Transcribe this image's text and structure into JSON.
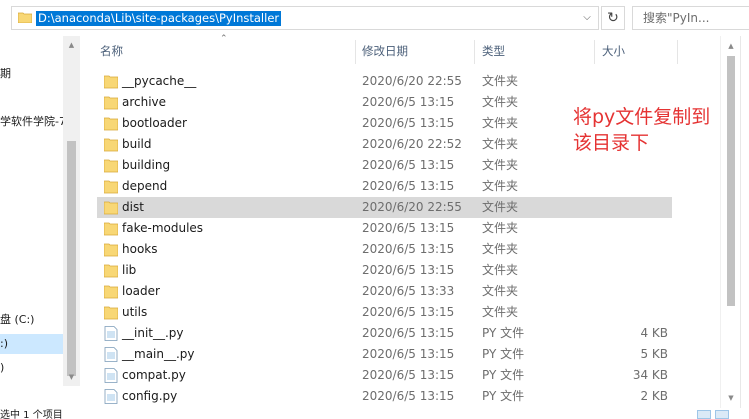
{
  "address": {
    "path": "D:\\anaconda\\Lib\\site-packages\\PyInstaller",
    "chevron": "v",
    "refresh_icon": "refresh-icon",
    "search_placeholder": "搜索\"PyIn..."
  },
  "nav": {
    "items": [
      "期",
      "学软件学院-7",
      "盘 (C:)",
      ":)",
      ")"
    ]
  },
  "columns": {
    "name": "名称",
    "date": "修改日期",
    "type": "类型",
    "size": "大小"
  },
  "files": [
    {
      "name": "__pycache__",
      "date": "2020/6/20 22:55",
      "type": "文件夹",
      "size": "",
      "icon": "folder-icon"
    },
    {
      "name": "archive",
      "date": "2020/6/5 13:15",
      "type": "文件夹",
      "size": "",
      "icon": "folder-icon"
    },
    {
      "name": "bootloader",
      "date": "2020/6/5 13:15",
      "type": "文件夹",
      "size": "",
      "icon": "folder-icon"
    },
    {
      "name": "build",
      "date": "2020/6/20 22:52",
      "type": "文件夹",
      "size": "",
      "icon": "folder-icon"
    },
    {
      "name": "building",
      "date": "2020/6/5 13:15",
      "type": "文件夹",
      "size": "",
      "icon": "folder-icon"
    },
    {
      "name": "depend",
      "date": "2020/6/5 13:15",
      "type": "文件夹",
      "size": "",
      "icon": "folder-icon"
    },
    {
      "name": "dist",
      "date": "2020/6/20 22:55",
      "type": "文件夹",
      "size": "",
      "icon": "folder-icon",
      "selected": true
    },
    {
      "name": "fake-modules",
      "date": "2020/6/5 13:15",
      "type": "文件夹",
      "size": "",
      "icon": "folder-icon"
    },
    {
      "name": "hooks",
      "date": "2020/6/5 13:15",
      "type": "文件夹",
      "size": "",
      "icon": "folder-icon"
    },
    {
      "name": "lib",
      "date": "2020/6/5 13:15",
      "type": "文件夹",
      "size": "",
      "icon": "folder-icon"
    },
    {
      "name": "loader",
      "date": "2020/6/5 13:33",
      "type": "文件夹",
      "size": "",
      "icon": "folder-icon"
    },
    {
      "name": "utils",
      "date": "2020/6/5 13:15",
      "type": "文件夹",
      "size": "",
      "icon": "folder-icon"
    },
    {
      "name": "__init__.py",
      "date": "2020/6/5 13:15",
      "type": "PY 文件",
      "size": "4 KB",
      "icon": "python-file-icon"
    },
    {
      "name": "__main__.py",
      "date": "2020/6/5 13:15",
      "type": "PY 文件",
      "size": "5 KB",
      "icon": "python-file-icon"
    },
    {
      "name": "compat.py",
      "date": "2020/6/5 13:15",
      "type": "PY 文件",
      "size": "34 KB",
      "icon": "python-file-icon"
    },
    {
      "name": "config.py",
      "date": "2020/6/5 13:15",
      "type": "PY 文件",
      "size": "2 KB",
      "icon": "python-file-icon"
    }
  ],
  "annotation": {
    "line1": "将py文件复制到",
    "line2": "该目录下",
    "color": "#e53333"
  },
  "status": {
    "text": "选中 1 个项目"
  },
  "colors": {
    "selection": "#0078d7",
    "folder": "#f8d775",
    "row_selected": "#d9d9d9"
  }
}
